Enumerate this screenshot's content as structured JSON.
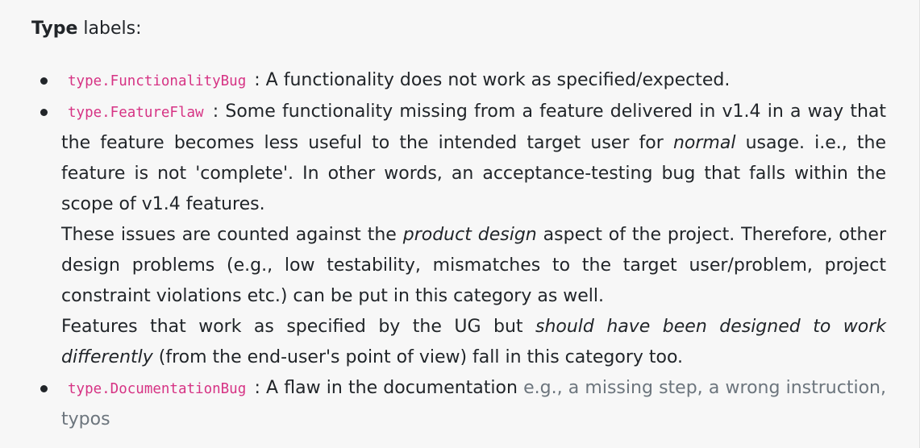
{
  "heading": {
    "bold": "Type",
    "rest": " labels:"
  },
  "items": [
    {
      "code": "type.FunctionalityBug",
      "sep": " : ",
      "text": "A functionality does not work as specified/expected."
    },
    {
      "code": "type.FeatureFlaw",
      "sep": " : ",
      "text_a": "Some functionality missing from a feature delivered in v1.4 in a way that the feature becomes less useful to the intended target user for ",
      "text_em": "normal",
      "text_b": " usage. i.e., the feature is not 'complete'. In other words, an acceptance-testing bug that falls within the scope of v1.4 features.",
      "p2_a": "These issues are counted against the ",
      "p2_em": "product design",
      "p2_b": " aspect of the project. Therefore, other design problems (e.g., low testability, mismatches to the target user/problem, project constraint violations etc.) can be put in this category as well.",
      "p3_a": "Features that work as specified by the UG but ",
      "p3_em": "should have been designed to work differently",
      "p3_b": " (from the end-user's point of view) fall in this category too."
    },
    {
      "code": "type.DocumentationBug",
      "sep": " : ",
      "text": "A flaw in the documentation ",
      "muted": "e.g., a missing step, a wrong instruction, typos"
    }
  ],
  "colors": {
    "background": "#f7f7f7",
    "text": "#212529",
    "code": "#d63384",
    "muted": "#6c757d"
  }
}
